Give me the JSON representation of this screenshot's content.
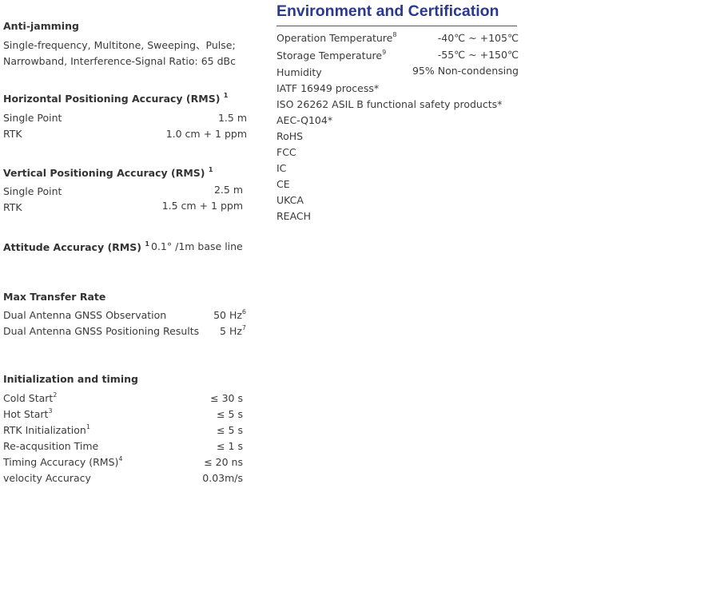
{
  "anti_jamming": {
    "heading": "Anti-jamming",
    "line1": "Single-frequency, Multitone, Sweeping、Pulse;",
    "line2": "Narrowband, Interference-Signal Ratio: 65 dBc"
  },
  "horizontal": {
    "heading": "Horizontal Positioning Accuracy (RMS)",
    "note": "1",
    "rows": [
      {
        "label": "Single Point",
        "value": "1.5 m"
      },
      {
        "label": "RTK",
        "value": "1.0 cm + 1 ppm"
      }
    ]
  },
  "vertical": {
    "heading": "Vertical Positioning Accuracy (RMS)",
    "note": "1",
    "rows": [
      {
        "label": "Single Point",
        "value": "2.5 m"
      },
      {
        "label": "RTK",
        "value": "1.5 cm + 1 ppm"
      }
    ]
  },
  "attitude": {
    "heading": "Attitude Accuracy (RMS)",
    "note": "1",
    "value": "0.1° /1m base line"
  },
  "transfer": {
    "heading": "Max Transfer Rate",
    "rows": [
      {
        "label": "Dual Antenna GNSS Observation",
        "value": "50 Hz",
        "note": "6"
      },
      {
        "label": "Dual Antenna GNSS Positioning Results",
        "value": "5 Hz",
        "note": "7"
      }
    ]
  },
  "init": {
    "heading": "Initialization and timing",
    "rows": [
      {
        "label": "Cold Start",
        "note": "2",
        "value": "≤ 30 s"
      },
      {
        "label": "Hot Start",
        "note": "3",
        "value": "≤ 5 s"
      },
      {
        "label": "RTK Initialization",
        "note": "1",
        "value": "≤ 5 s"
      },
      {
        "label": "Re-acqusition Time",
        "note": "",
        "value": "≤ 1 s"
      },
      {
        "label": "Timing Accuracy (RMS)",
        "note": "4",
        "value": "≤ 20 ns"
      },
      {
        "label": "velocity Accuracy",
        "note": "",
        "value": "0.03m/s"
      }
    ]
  },
  "environment": {
    "title": "Environment and Certification",
    "rows": [
      {
        "label": "Operation Temperature",
        "note": "8",
        "value": "-40℃ ~ +105℃"
      },
      {
        "label": "Storage Temperature",
        "note": "9",
        "value": "-55℃ ~ +150℃"
      },
      {
        "label": "Humidity",
        "note": "",
        "value": "95% Non-condensing"
      }
    ],
    "certifications": [
      "IATF 16949 process*",
      "ISO 26262 ASIL B functional safety products*",
      "AEC-Q104*",
      "RoHS",
      "FCC",
      "IC",
      "CE",
      "UKCA",
      "REACH"
    ]
  }
}
